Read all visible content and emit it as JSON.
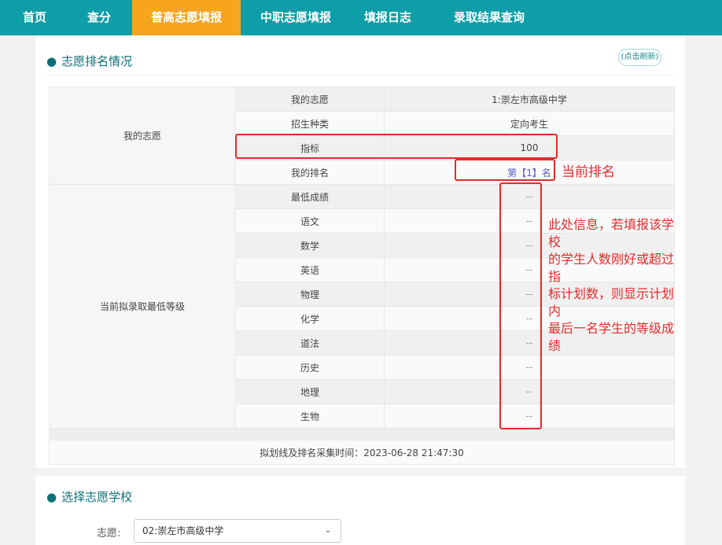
{
  "nav": {
    "items": [
      "首页",
      "查分",
      "普高志愿填报",
      "中职志愿填报",
      "填报日志",
      "录取结果查询"
    ],
    "active_index": 2,
    "bg_color": "#0e9ea7",
    "active_color": "#f7a51c"
  },
  "ranking": {
    "title": "志愿排名情况",
    "refresh_label": "(点击刷新)",
    "group1_label": "我的志愿",
    "rows1": [
      {
        "label": "我的志愿",
        "value": "1:崇左市高级中学"
      },
      {
        "label": "招生种类",
        "value": "定向考生"
      },
      {
        "label": "指标",
        "value": "100"
      },
      {
        "label": "我的排名",
        "value": "第【1】名"
      }
    ],
    "group2_label": "当前拟录取最低等级",
    "rows2": [
      {
        "label": "最低成绩",
        "value": "--"
      },
      {
        "label": "语文",
        "value": "--"
      },
      {
        "label": "数学",
        "value": "--"
      },
      {
        "label": "英语",
        "value": "--"
      },
      {
        "label": "物理",
        "value": "--"
      },
      {
        "label": "化学",
        "value": "--"
      },
      {
        "label": "道法",
        "value": "--"
      },
      {
        "label": "历史",
        "value": "--"
      },
      {
        "label": "地理",
        "value": "--"
      },
      {
        "label": "生物",
        "value": "--"
      }
    ],
    "footer": "拟划线及排名采集时间：2023-06-28 21:47:30"
  },
  "annotations": {
    "rank_note": "当前排名",
    "info_lines": [
      "此处信息，若填报该学校",
      "的学生人数刚好或超过指",
      "标计划数，则显示计划内",
      "最后一名学生的等级成绩"
    ],
    "color": "#e52b2b"
  },
  "school_select": {
    "title": "选择志愿学校",
    "label": "志愿:",
    "selected": "02:崇左市高级中学",
    "chevron": "chevron-down-icon"
  }
}
